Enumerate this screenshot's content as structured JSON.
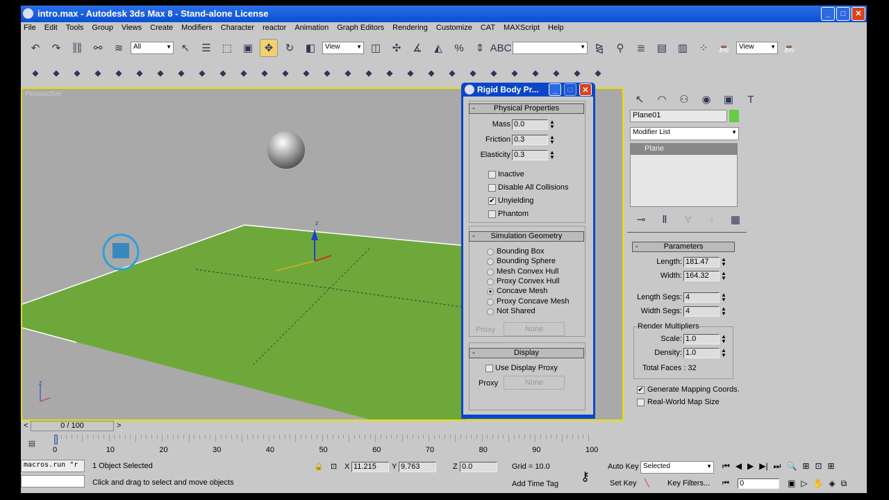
{
  "window": {
    "title": "intro.max - Autodesk 3ds Max 8 - Stand-alone License",
    "minimize": "_",
    "maximize": "□",
    "close": "✕"
  },
  "menu": [
    "File",
    "Edit",
    "Tools",
    "Group",
    "Views",
    "Create",
    "Modifiers",
    "Character",
    "reactor",
    "Animation",
    "Graph Editors",
    "Rendering",
    "Customize",
    "CAT",
    "MAXScript",
    "Help"
  ],
  "toolbar1": {
    "selection_filter": "All",
    "ref_coord": "View",
    "named_sel": "",
    "view_dd": "View"
  },
  "viewport": {
    "label": "Perspective",
    "axis_z": "z"
  },
  "rigid_body": {
    "title": "Rigid Body Pr...",
    "physical": {
      "header": "Physical Properties",
      "mass_label": "Mass",
      "mass": "0.0",
      "friction_label": "Friction",
      "friction": "0.3",
      "elasticity_label": "Elasticity",
      "elasticity": "0.3",
      "checks": [
        {
          "label": "Inactive",
          "checked": false
        },
        {
          "label": "Disable All Collisions",
          "checked": false
        },
        {
          "label": "Unyielding",
          "checked": true
        },
        {
          "label": "Phantom",
          "checked": false
        }
      ]
    },
    "sim": {
      "header": "Simulation Geometry",
      "options": [
        "Bounding Box",
        "Bounding Sphere",
        "Mesh Convex Hull",
        "Proxy Convex Hull",
        "Concave Mesh",
        "Proxy Concave Mesh",
        "Not Shared"
      ],
      "selected": "Concave Mesh",
      "proxy_label": "Proxy",
      "proxy_value": "None"
    },
    "display": {
      "header": "Display",
      "use_proxy": "Use Display Proxy",
      "proxy_label": "Proxy",
      "proxy_value": "None"
    }
  },
  "command_panel": {
    "object_name": "Plane01",
    "object_color": "#66cc44",
    "modifier_list": "Modifier List",
    "stack": [
      "Plane"
    ],
    "parameters": {
      "header": "Parameters",
      "length_label": "Length:",
      "length": "181.47",
      "width_label": "Width:",
      "width": "164.32",
      "length_segs_label": "Length Segs:",
      "length_segs": "4",
      "width_segs_label": "Width Segs:",
      "width_segs": "4",
      "render_mult": "Render Multipliers",
      "scale_label": "Scale:",
      "scale": "1.0",
      "density_label": "Density:",
      "density": "1.0",
      "total_faces": "Total Faces : 32",
      "gen_mapping": "Generate Mapping Coords.",
      "real_world": "Real-World Map Size"
    }
  },
  "timeline": {
    "frame": "0 / 100",
    "ticks": [
      "0",
      "10",
      "20",
      "30",
      "40",
      "50",
      "60",
      "70",
      "80",
      "90",
      "100"
    ]
  },
  "status": {
    "maxscript": "macros.run \"r",
    "selected": "1 Object Selected",
    "prompt": "Click and drag to select and move objects",
    "x_label": "X",
    "x": "11.215",
    "y_label": "Y",
    "y": "9.763",
    "z_label": "Z",
    "z": "0.0",
    "grid": "Grid = 10.0",
    "add_time_tag": "Add Time Tag",
    "auto_key": "Auto Key",
    "set_key": "Set Key",
    "key_mode": "Selected",
    "key_filters": "Key Filters...",
    "current_frame": "0"
  }
}
